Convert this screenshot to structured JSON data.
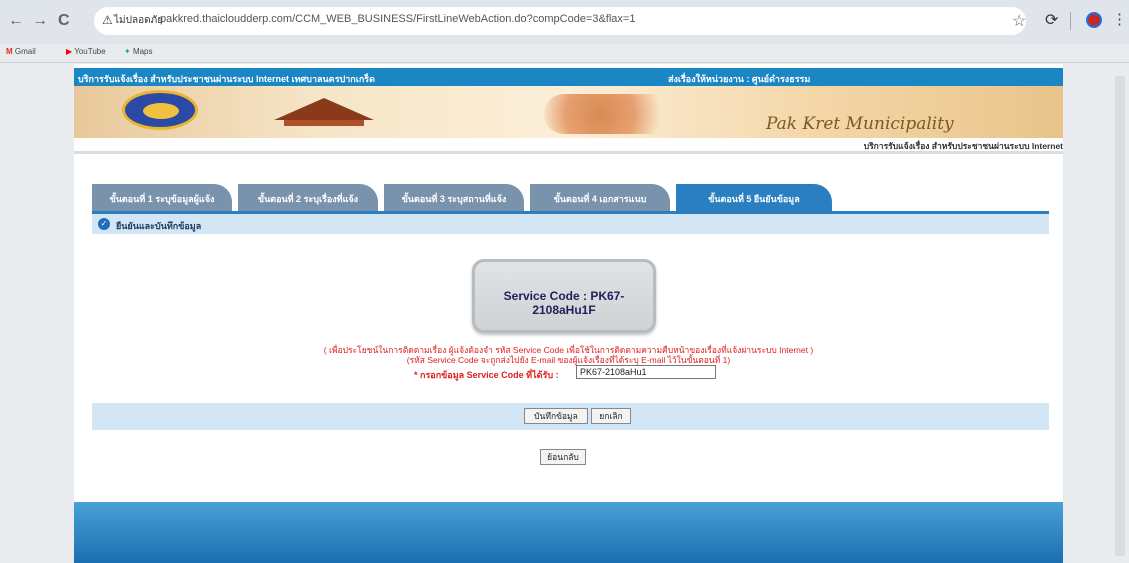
{
  "browser": {
    "nav_back": "←",
    "nav_forward": "→",
    "nav_reload": "C",
    "warning_icon": "⚠",
    "security_label": "ไม่ปลอดภัย",
    "url": "pakkred.thaicloudderp.com/CCM_WEB_BUSINESS/FirstLineWebAction.do?compCode=3&flax=1",
    "star_icon": "☆",
    "extension_icon": "⟳",
    "menu_icon": "⋮",
    "bookmarks": [
      {
        "label": "Gmail",
        "icon": "M",
        "color": "#d93025"
      },
      {
        "label": "YouTube",
        "icon": "▶",
        "color": "#ff0000"
      },
      {
        "label": "Maps",
        "icon": "✦",
        "color": "#34a853"
      }
    ]
  },
  "page": {
    "topbar_left": "บริการรับแจ้งเรื่อง สำหรับประชาชนผ่านระบบ Internet เทศบาลนครปากเกร็ด",
    "topbar_right": "ส่งเรื่องให้หน่วยงาน : ศูนย์ดำรงธรรม",
    "brand": "Pak Kret Municipality",
    "subtitle": "บริการรับแจ้งเรื่อง สำหรับประชาชนผ่านระบบ Internet",
    "tabs": [
      "ขั้นตอนที่ 1 ระบุข้อมูลผู้แจ้ง",
      "ขั้นตอนที่ 2 ระบุเรื่องที่แจ้ง",
      "ขั้นตอนที่ 3 ระบุสถานที่แจ้ง",
      "ขั้นตอนที่ 4 เอกสารแนบ",
      "ขั้นตอนที่ 5 ยืนยันข้อมูล"
    ],
    "section_title": "ยืนยันและบันทึกข้อมูล",
    "service_code_display": "Service Code : PK67-2108aHu1F",
    "note_line1": "( เพื่อประโยชน์ในการติดตามเรื่อง ผู้แจ้งต้องจำ รหัส Service Code เพื่อใช้ในการติดตามความคืบหน้าของเรื่องที่แจ้งผ่านระบบ Internet )",
    "note_line2": "(รหัส Service Code จะถูกส่งไปยัง E-mail ของผู้แจ้งเรื่องที่ได้ระบุ E-mail ไว้ในขั้นตอนที่ 1)",
    "input_label": "* กรอกข้อมูล Service Code ที่ได้รับ :",
    "input_value": "PK67-2108aHu1",
    "save_label": "บันทึกข้อมูล",
    "cancel_label": "ยกเลิก",
    "back_label": "ย้อนกลับ"
  }
}
